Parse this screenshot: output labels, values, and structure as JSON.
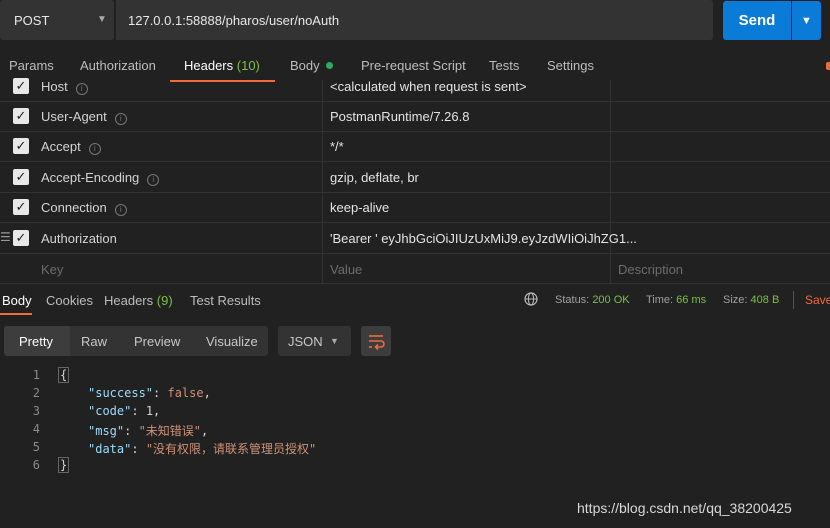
{
  "request": {
    "method": "POST",
    "url": "127.0.0.1:58888/pharos/user/noAuth",
    "send_label": "Send"
  },
  "request_tabs": {
    "params": "Params",
    "authorization": "Authorization",
    "headers": "Headers",
    "headers_count": "(10)",
    "body": "Body",
    "prerequest": "Pre-request Script",
    "tests": "Tests",
    "settings": "Settings"
  },
  "headers": [
    {
      "key": "Host",
      "value": "<calculated when request is sent>",
      "checked": true
    },
    {
      "key": "User-Agent",
      "value": "PostmanRuntime/7.26.8",
      "checked": true
    },
    {
      "key": "Accept",
      "value": "*/*",
      "checked": true
    },
    {
      "key": "Accept-Encoding",
      "value": "gzip, deflate, br",
      "checked": true
    },
    {
      "key": "Connection",
      "value": "keep-alive",
      "checked": true
    },
    {
      "key": "Authorization",
      "value": "'Bearer ' eyJhbGciOiJIUzUxMiJ9.eyJzdWIiOiJhZG1...",
      "checked": true
    }
  ],
  "new_header": {
    "key_placeholder": "Key",
    "value_placeholder": "Value",
    "description_placeholder": "Description"
  },
  "response_tabs": {
    "body": "Body",
    "cookies": "Cookies",
    "headers": "Headers",
    "headers_count": "(9)",
    "test_results": "Test Results"
  },
  "response_status": {
    "status_label": "Status:",
    "status_value": "200 OK",
    "time_label": "Time:",
    "time_value": "66 ms",
    "size_label": "Size:",
    "size_value": "408 B",
    "save_label": "Save"
  },
  "view_tabs": {
    "pretty": "Pretty",
    "raw": "Raw",
    "preview": "Preview",
    "visualize": "Visualize",
    "format": "JSON"
  },
  "code": {
    "line_numbers": [
      "1",
      "2",
      "3",
      "4",
      "5",
      "6"
    ],
    "open_brace": "{",
    "close_brace": "}",
    "success_key": "\"success\"",
    "success_val": "false",
    "code_key": "\"code\"",
    "code_val": "1",
    "msg_key": "\"msg\"",
    "msg_val": "\"未知错误\"",
    "data_key": "\"data\"",
    "data_val": "\"没有权限，请联系管理员授权\""
  },
  "watermark": "https://blog.csdn.net/qq_38200425",
  "colors": {
    "accent": "#f26b3a",
    "send": "#0a7bd6",
    "status_ok": "#7ac043",
    "background": "#212121"
  }
}
